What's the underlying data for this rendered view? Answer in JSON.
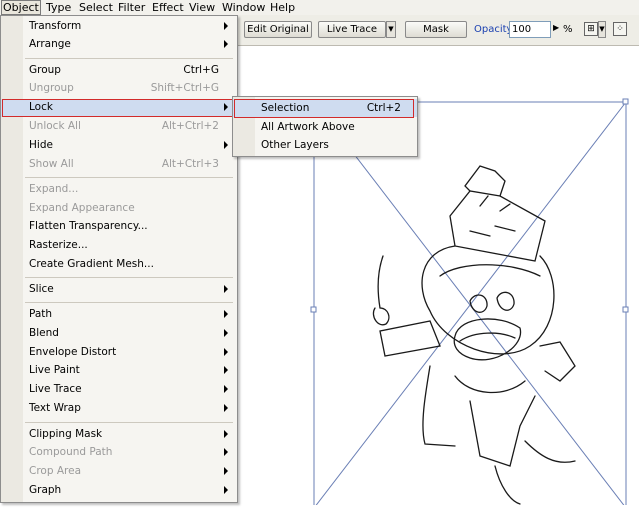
{
  "menubar": {
    "items": [
      "Object",
      "Type",
      "Select",
      "Filter",
      "Effect",
      "View",
      "Window",
      "Help"
    ]
  },
  "control_bar": {
    "edit_original": "Edit Original",
    "live_trace": "Live Trace",
    "mask": "Mask",
    "opacity_label": "Opacity:",
    "opacity_value": "100",
    "percent": "%"
  },
  "object_menu": {
    "items": [
      {
        "label": "Transform",
        "shortcut": "",
        "submenu": true,
        "disabled": false
      },
      {
        "label": "Arrange",
        "shortcut": "",
        "submenu": true,
        "disabled": false
      },
      {
        "label": "Group",
        "shortcut": "Ctrl+G",
        "submenu": false,
        "disabled": false
      },
      {
        "label": "Ungroup",
        "shortcut": "Shift+Ctrl+G",
        "submenu": false,
        "disabled": true
      },
      {
        "label": "Lock",
        "shortcut": "",
        "submenu": true,
        "disabled": false,
        "highlighted": true
      },
      {
        "label": "Unlock All",
        "shortcut": "Alt+Ctrl+2",
        "submenu": false,
        "disabled": true
      },
      {
        "label": "Hide",
        "shortcut": "",
        "submenu": true,
        "disabled": false
      },
      {
        "label": "Show All",
        "shortcut": "Alt+Ctrl+3",
        "submenu": false,
        "disabled": true
      },
      {
        "label": "Expand...",
        "shortcut": "",
        "submenu": false,
        "disabled": true
      },
      {
        "label": "Expand Appearance",
        "shortcut": "",
        "submenu": false,
        "disabled": true
      },
      {
        "label": "Flatten Transparency...",
        "shortcut": "",
        "submenu": false,
        "disabled": false
      },
      {
        "label": "Rasterize...",
        "shortcut": "",
        "submenu": false,
        "disabled": false
      },
      {
        "label": "Create Gradient Mesh...",
        "shortcut": "",
        "submenu": false,
        "disabled": false
      },
      {
        "label": "Slice",
        "shortcut": "",
        "submenu": true,
        "disabled": false
      },
      {
        "label": "Path",
        "shortcut": "",
        "submenu": true,
        "disabled": false
      },
      {
        "label": "Blend",
        "shortcut": "",
        "submenu": true,
        "disabled": false
      },
      {
        "label": "Envelope Distort",
        "shortcut": "",
        "submenu": true,
        "disabled": false
      },
      {
        "label": "Live Paint",
        "shortcut": "",
        "submenu": true,
        "disabled": false
      },
      {
        "label": "Live Trace",
        "shortcut": "",
        "submenu": true,
        "disabled": false
      },
      {
        "label": "Text Wrap",
        "shortcut": "",
        "submenu": true,
        "disabled": false
      },
      {
        "label": "Clipping Mask",
        "shortcut": "",
        "submenu": true,
        "disabled": false
      },
      {
        "label": "Compound Path",
        "shortcut": "",
        "submenu": true,
        "disabled": true
      },
      {
        "label": "Crop Area",
        "shortcut": "",
        "submenu": true,
        "disabled": true
      },
      {
        "label": "Graph",
        "shortcut": "",
        "submenu": true,
        "disabled": false
      }
    ]
  },
  "lock_submenu": {
    "items": [
      {
        "label": "Selection",
        "shortcut": "Ctrl+2",
        "highlighted": true
      },
      {
        "label": "All Artwork Above",
        "shortcut": ""
      },
      {
        "label": "Other Layers",
        "shortcut": ""
      }
    ]
  },
  "colors": {
    "highlight_outline": "#d22b2b",
    "highlight_fill": "#cfdcf0",
    "disabled_text": "#9a9a9a",
    "opacity_label": "#1a3fb0"
  }
}
